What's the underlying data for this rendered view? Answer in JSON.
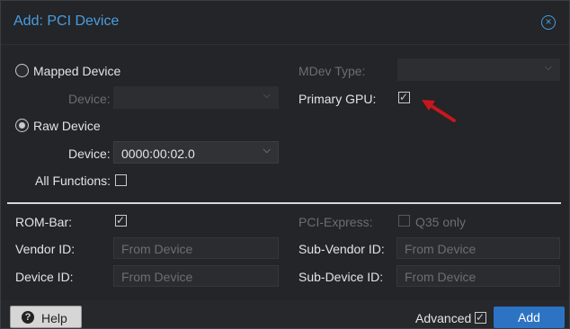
{
  "dialog": {
    "title": "Add: PCI Device",
    "close_icon": "close-circle-icon"
  },
  "mapped_device": {
    "label": "Mapped Device",
    "selected": false,
    "device_label": "Device:",
    "device_value": ""
  },
  "raw_device": {
    "label": "Raw Device",
    "selected": true,
    "device_label": "Device:",
    "device_value": "0000:00:02.0",
    "all_functions_label": "All Functions:",
    "all_functions_checked": false
  },
  "right_top": {
    "mdev_type_label": "MDev Type:",
    "mdev_type_value": "",
    "primary_gpu_label": "Primary GPU:",
    "primary_gpu_checked": true
  },
  "advanced_section": {
    "rom_bar_label": "ROM-Bar:",
    "rom_bar_checked": true,
    "vendor_id_label": "Vendor ID:",
    "vendor_id_placeholder": "From Device",
    "device_id_label": "Device ID:",
    "device_id_placeholder": "From Device",
    "pci_express_label": "PCI-Express:",
    "q35_only_label": "Q35 only",
    "sub_vendor_id_label": "Sub-Vendor ID:",
    "sub_vendor_id_placeholder": "From Device",
    "sub_device_id_label": "Sub-Device ID:",
    "sub_device_id_placeholder": "From Device"
  },
  "footer": {
    "help_label": "Help",
    "advanced_label": "Advanced",
    "advanced_checked": true,
    "add_label": "Add"
  },
  "colors": {
    "accent": "#4a9de0",
    "primary_button": "#2d73c4",
    "annotation_arrow": "#c8161d"
  }
}
